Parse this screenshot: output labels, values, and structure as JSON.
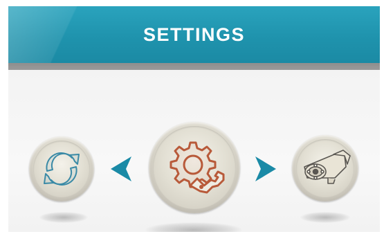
{
  "header": {
    "title": "SETTINGS"
  },
  "carousel": {
    "left_item": {
      "icon": "refresh-icon",
      "label": ""
    },
    "center_item": {
      "icon": "settings-gear-wrench-icon",
      "label": ""
    },
    "right_item": {
      "icon": "security-camera-icon",
      "label": ""
    },
    "prev_arrow": {
      "icon": "chevron-left-icon"
    },
    "next_arrow": {
      "icon": "chevron-right-icon"
    }
  },
  "colors": {
    "header_bg": "#1f93ad",
    "header_band": "#959595",
    "accent_arrow": "#1a8aa6",
    "gear_icon": "#b85a3a",
    "refresh_icon": "#3a8aa6",
    "camera_icon": "#5a5752"
  }
}
